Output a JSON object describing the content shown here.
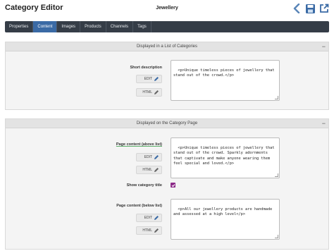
{
  "header": {
    "app_title": "Category Editor",
    "record_title": "Jewellery",
    "icons": [
      "back-arrow-icon",
      "save-icon",
      "open-external-icon"
    ]
  },
  "tabs": [
    {
      "label": "Properties",
      "active": false
    },
    {
      "label": "Content",
      "active": true
    },
    {
      "label": "Images",
      "active": false
    },
    {
      "label": "Products",
      "active": false
    },
    {
      "label": "Channels",
      "active": false
    },
    {
      "label": "Tags",
      "active": false
    }
  ],
  "panel_list": {
    "title": "Displayed in a List of Categories",
    "collapse_glyph": "−",
    "short_description": {
      "label": "Short description",
      "edit_label": "EDIT",
      "html_label": "HTML",
      "value": "<p>Unique timeless pieces of jewellery that stand out of the crowd.</p>"
    }
  },
  "panel_page": {
    "title": "Displayed on the Category Page",
    "collapse_glyph": "−",
    "content_above": {
      "label": "Page content (above list)",
      "edit_label": "EDIT",
      "html_label": "HTML",
      "value": "<p>Unique timeless pieces of jewellery that stand out of the crowd. Sparkly adornments that captivate and make anyone wearing them feel special and loved.</p>"
    },
    "show_title": {
      "label": "Show category title",
      "checked": true
    },
    "content_below": {
      "label": "Page content (below list)",
      "edit_label": "EDIT",
      "html_label": "HTML",
      "value": "<p>All our jewellery products are handmade and assessed at a high level</p>"
    }
  },
  "colors": {
    "tabbar": "#353d47",
    "active_tab": "#3a6aa5",
    "edit_icon": "#3a6aa5",
    "checkbox": "#8c2a88",
    "label_underline": "#5cae6a"
  }
}
